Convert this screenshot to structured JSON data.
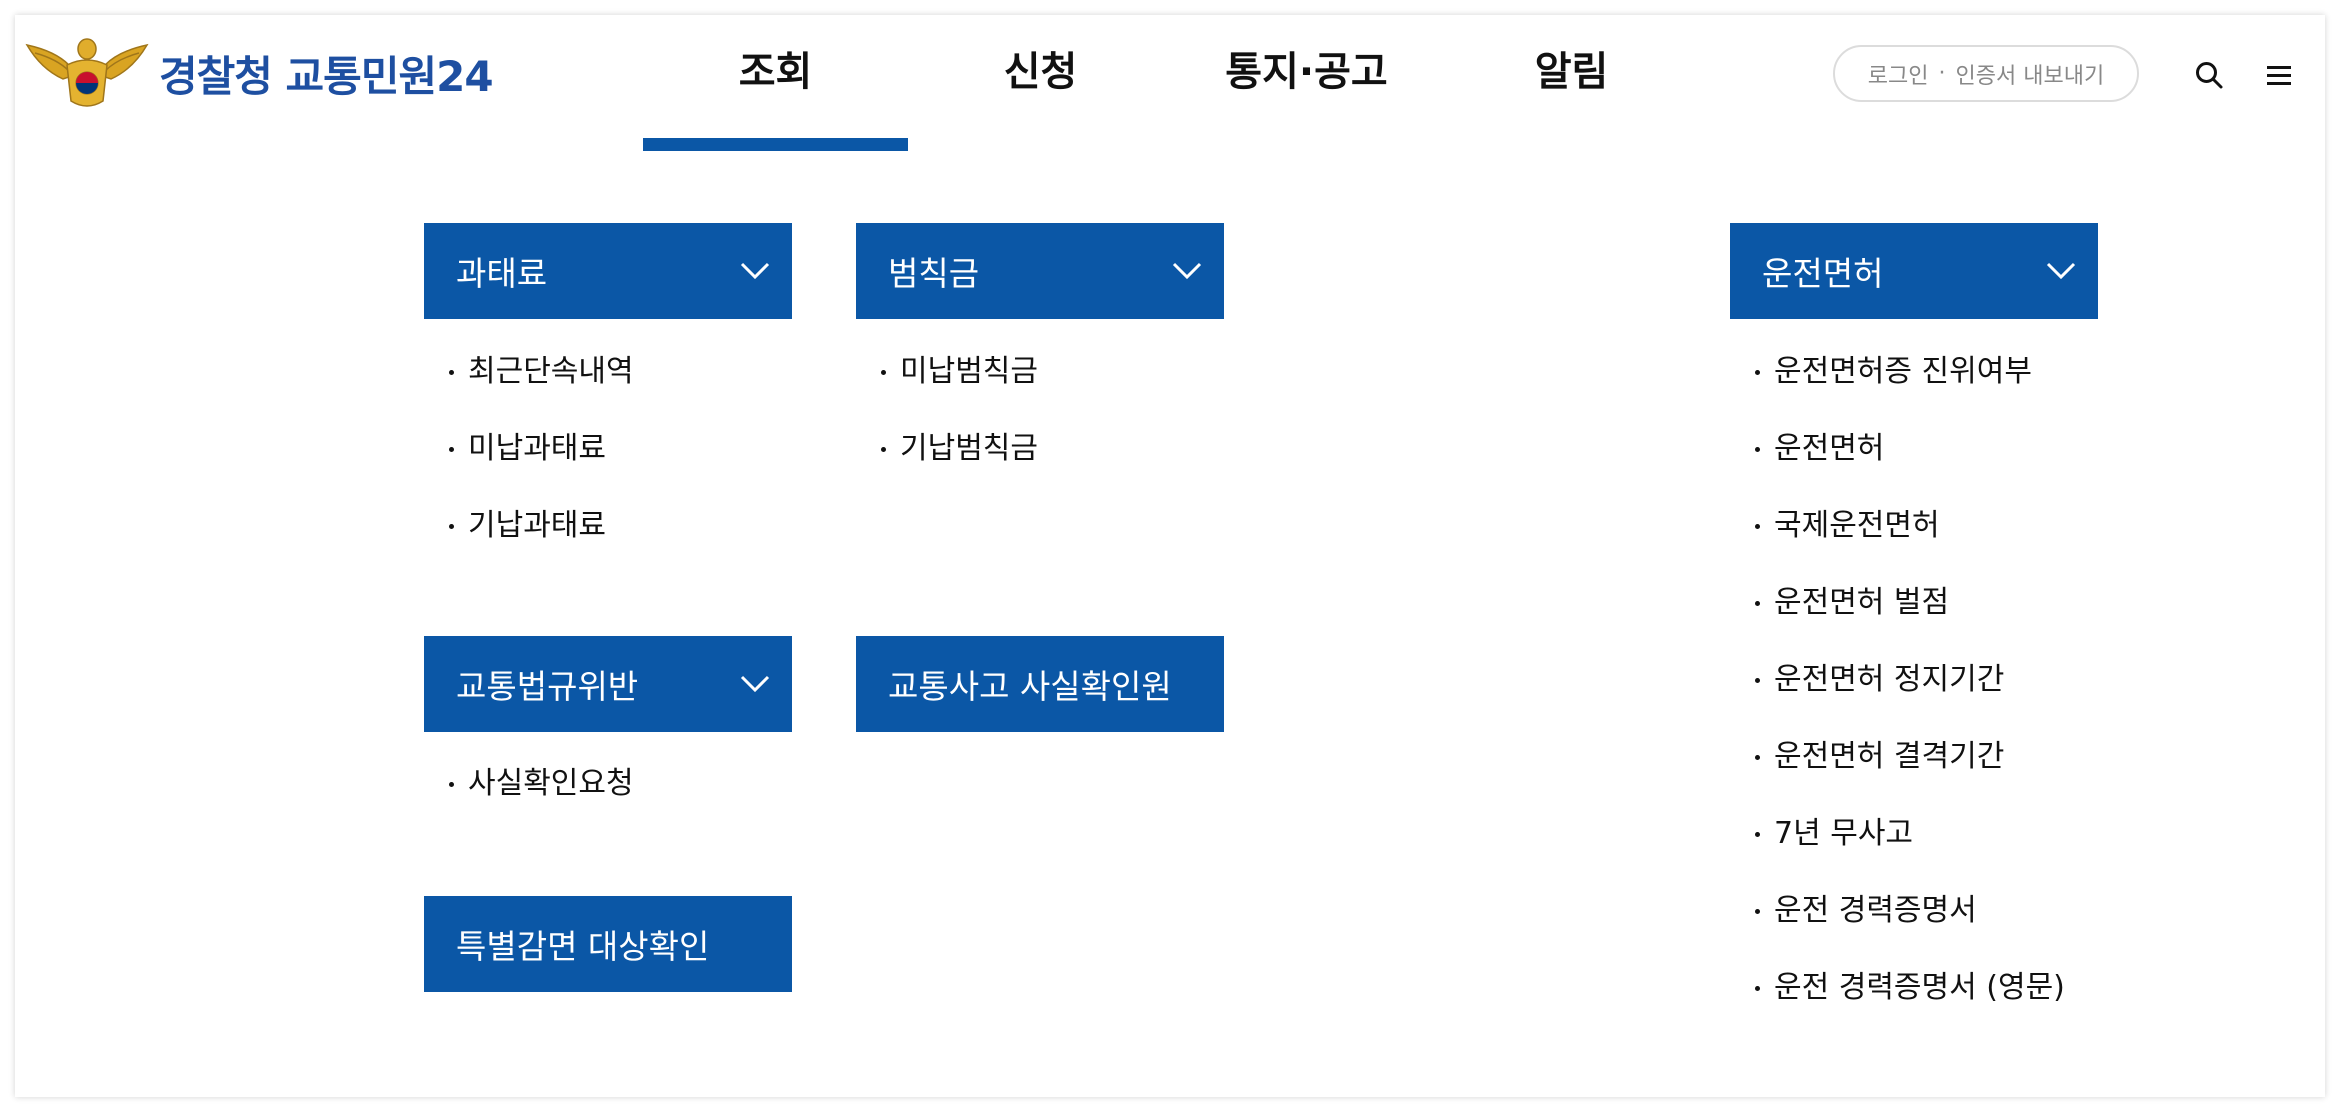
{
  "brand": {
    "name": "경찰청 교통민원24",
    "accent": "#0b57a6",
    "logo_color": "#1e4fa1"
  },
  "nav": {
    "items": [
      {
        "label": "조회",
        "active": true
      },
      {
        "label": "신청",
        "active": false
      },
      {
        "label": "통지·공고",
        "active": false
      },
      {
        "label": "알림",
        "active": false
      }
    ]
  },
  "header": {
    "login_label": "로그인",
    "cert_label": "인증서 내보내기",
    "search_icon": "search-icon",
    "menu_icon": "hamburger-menu-icon"
  },
  "menu": {
    "fine": {
      "title": "과태료",
      "items": [
        "최근단속내역",
        "미납과태료",
        "기납과태료"
      ]
    },
    "penalty": {
      "title": "범칙금",
      "items": [
        "미납범칙금",
        "기납범칙금"
      ]
    },
    "license": {
      "title": "운전면허",
      "items": [
        "운전면허증 진위여부",
        "운전면허",
        "국제운전면허",
        "운전면허 벌점",
        "운전면허 정지기간",
        "운전면허 결격기간",
        "7년 무사고",
        "운전 경력증명서",
        "운전 경력증명서 (영문)"
      ]
    },
    "violation": {
      "title": "교통법규위반",
      "items": [
        "사실확인요청"
      ]
    },
    "accident": {
      "title": "교통사고 사실확인원"
    },
    "special": {
      "title": "특별감면 대상확인"
    }
  }
}
